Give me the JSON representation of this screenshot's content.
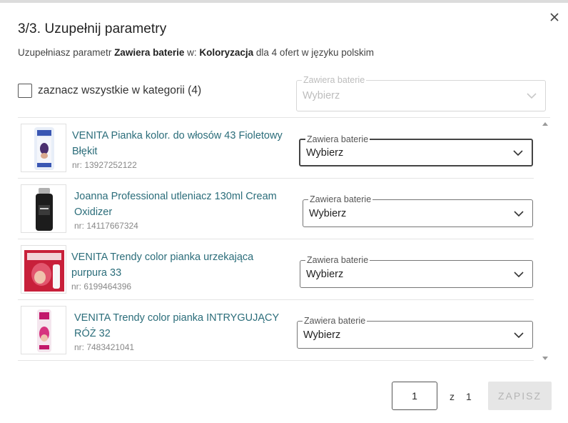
{
  "dialog": {
    "title": "3/3. Uzupełnij parametry",
    "subtitle_prefix": "Uzupełniasz parametr ",
    "subtitle_param": "Zawiera baterie",
    "subtitle_mid": " w: ",
    "subtitle_category": "Koloryzacja",
    "subtitle_suffix": " dla 4 ofert w języku polskim"
  },
  "select_all": {
    "label": "zaznacz wszystkie w kategorii (4)",
    "field_legend": "Zawiera baterie",
    "field_value": "Wybierz"
  },
  "offers": [
    {
      "name": "VENITA Pianka kolor. do włosów 43 Fioletowy Błękit",
      "nr": "nr: 13927252122",
      "field_legend": "Zawiera baterie",
      "field_value": "Wybierz"
    },
    {
      "name": "Joanna Professional utleniacz 130ml Cream Oxidizer",
      "nr": "nr: 14117667324",
      "field_legend": "Zawiera baterie",
      "field_value": "Wybierz"
    },
    {
      "name": "VENITA Trendy color pianka urzekająca purpura 33",
      "nr": "nr: 6199464396",
      "field_legend": "Zawiera baterie",
      "field_value": "Wybierz"
    },
    {
      "name": "VENITA Trendy color pianka INTRYGUJĄCY RÓŻ 32",
      "nr": "nr: 7483421041",
      "field_legend": "Zawiera baterie",
      "field_value": "Wybierz"
    }
  ],
  "pagination": {
    "current": "1",
    "of_label": "z",
    "total": "1"
  },
  "save_label": "ZAPISZ",
  "colors": {
    "link": "#2b6d7a",
    "save_disabled_bg": "#e6e6e6"
  }
}
